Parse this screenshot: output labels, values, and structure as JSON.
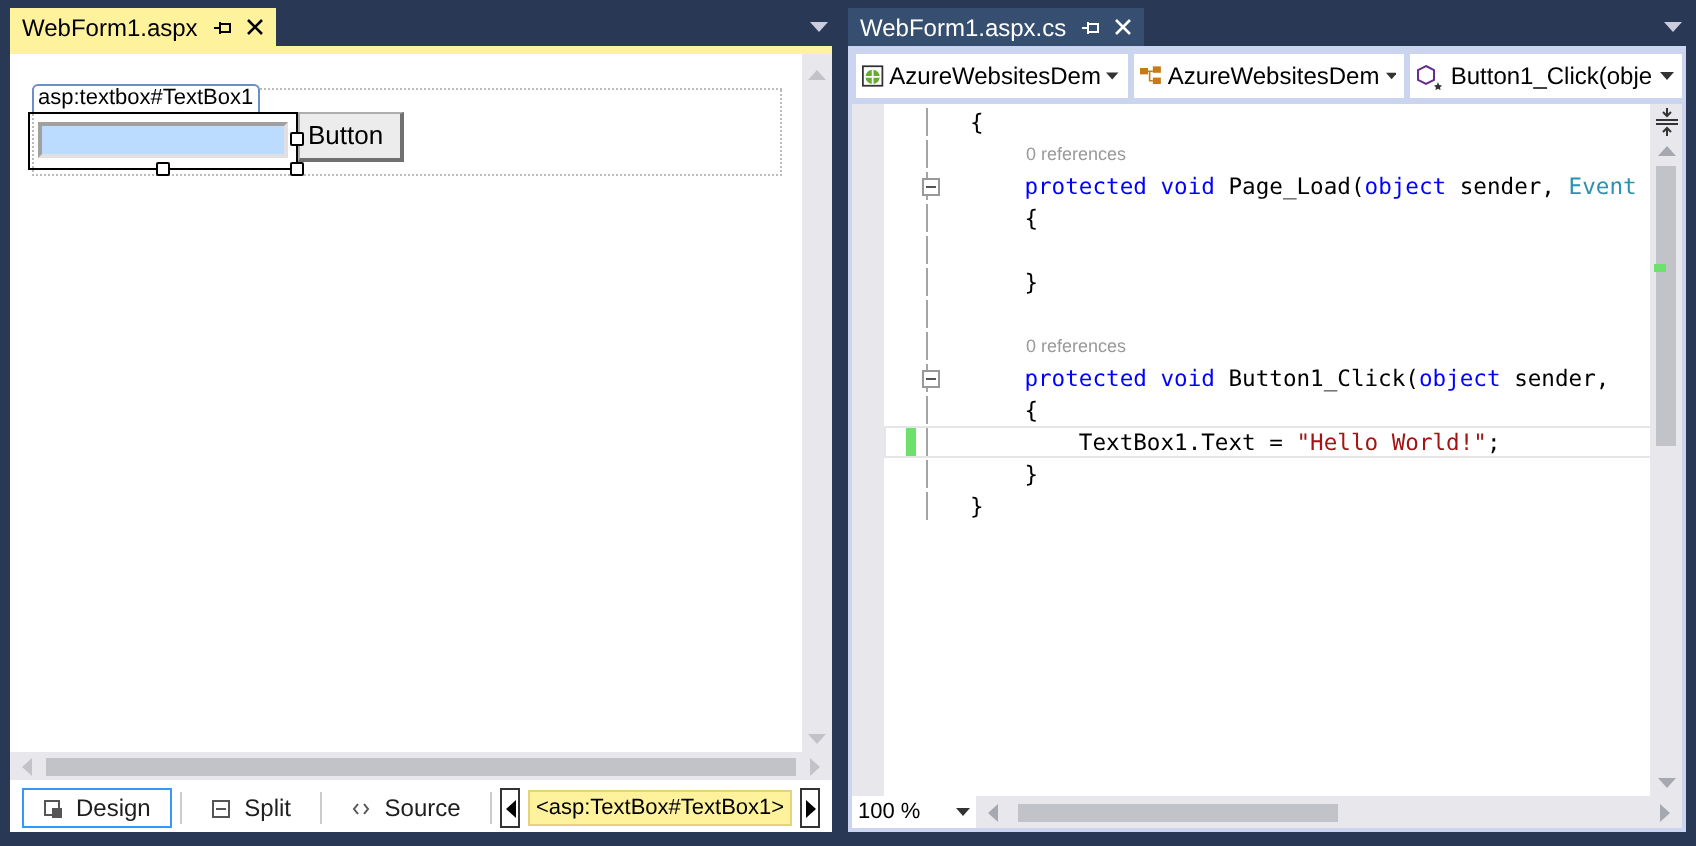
{
  "design_pane": {
    "tab": {
      "title": "WebForm1.aspx",
      "selected": true
    },
    "tag_label": "asp:textbox#TextBox1",
    "button_label": "Button",
    "views": [
      {
        "label": "Design",
        "selected": true
      },
      {
        "label": "Split",
        "selected": false
      },
      {
        "label": "Source",
        "selected": false
      }
    ],
    "breadcrumb": "<asp:TextBox#TextBox1>"
  },
  "code_pane": {
    "tab": {
      "title": "WebForm1.aspx.cs",
      "selected": false
    },
    "dropdowns": [
      "AzureWebsitesDem",
      "AzureWebsitesDem",
      "Button1_Click(obje"
    ],
    "lines": [
      {
        "kind": "code",
        "fold": false,
        "current": false,
        "changed": false,
        "tokens": [
          {
            "kind": "plain",
            "t": "{"
          }
        ]
      },
      {
        "kind": "lens",
        "text": "0 references"
      },
      {
        "kind": "code",
        "fold": true,
        "current": false,
        "changed": false,
        "tokens": [
          {
            "kind": "kw",
            "t": "    protected void"
          },
          {
            "kind": "plain",
            "t": " Page_Load("
          },
          {
            "kind": "kw",
            "t": "object"
          },
          {
            "kind": "plain",
            "t": " sender, "
          },
          {
            "kind": "type",
            "t": "Event"
          }
        ]
      },
      {
        "kind": "code",
        "fold": false,
        "current": false,
        "changed": false,
        "tokens": [
          {
            "kind": "plain",
            "t": "    {"
          }
        ]
      },
      {
        "kind": "blank"
      },
      {
        "kind": "code",
        "fold": false,
        "current": false,
        "changed": false,
        "tokens": [
          {
            "kind": "plain",
            "t": "    }"
          }
        ]
      },
      {
        "kind": "blank"
      },
      {
        "kind": "lens",
        "text": "0 references"
      },
      {
        "kind": "code",
        "fold": true,
        "current": false,
        "changed": false,
        "tokens": [
          {
            "kind": "kw",
            "t": "    protected void"
          },
          {
            "kind": "plain",
            "t": " Button1_Click("
          },
          {
            "kind": "kw",
            "t": "object"
          },
          {
            "kind": "plain",
            "t": " sender,"
          }
        ]
      },
      {
        "kind": "code",
        "fold": false,
        "current": false,
        "changed": false,
        "tokens": [
          {
            "kind": "plain",
            "t": "    {"
          }
        ]
      },
      {
        "kind": "code",
        "fold": false,
        "current": true,
        "changed": true,
        "tokens": [
          {
            "kind": "plain",
            "t": "        TextBox1.Text = "
          },
          {
            "kind": "str",
            "t": "\"Hello World!\""
          },
          {
            "kind": "plain",
            "t": ";"
          }
        ]
      },
      {
        "kind": "code",
        "fold": false,
        "current": false,
        "changed": false,
        "tokens": [
          {
            "kind": "plain",
            "t": "    }"
          }
        ]
      },
      {
        "kind": "code",
        "fold": false,
        "current": false,
        "changed": false,
        "tokens": [
          {
            "kind": "plain",
            "t": "}"
          }
        ]
      }
    ],
    "zoom": "100 %"
  }
}
